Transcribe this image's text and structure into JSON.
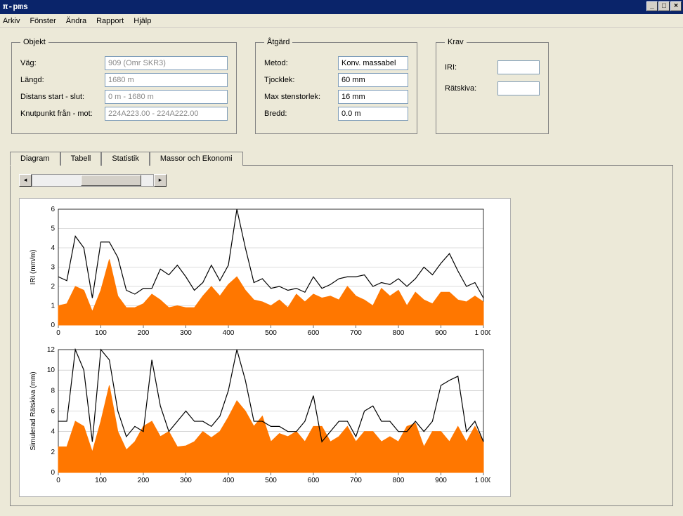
{
  "title": "π-pms",
  "menu": [
    "Arkiv",
    "Fönster",
    "Ändra",
    "Rapport",
    "Hjälp"
  ],
  "objekt": {
    "legend": "Objekt",
    "vag_label": "Väg:",
    "vag_value": "909 (Omr SKR3)",
    "langd_label": "Längd:",
    "langd_value": "1680 m",
    "dist_label": "Distans start - slut:",
    "dist_value": "0 m - 1680 m",
    "knut_label": "Knutpunkt från - mot:",
    "knut_value": "224A223.00 - 224A222.00"
  },
  "atgard": {
    "legend": "Åtgärd",
    "metod_label": "Metod:",
    "metod_value": "Konv. massabel",
    "tjocklek_label": "Tjocklek:",
    "tjocklek_value": "60 mm",
    "maxsten_label": "Max stenstorlek:",
    "maxsten_value": "16 mm",
    "bredd_label": "Bredd:",
    "bredd_value": "0.0 m"
  },
  "krav": {
    "legend": "Krav",
    "iri_label": "IRI:",
    "iri_value": "",
    "rat_label": "Rätskiva:",
    "rat_value": ""
  },
  "tabs": {
    "diagram": "Diagram",
    "tabell": "Tabell",
    "statistik": "Statistik",
    "massor": "Massor och Ekonomi"
  },
  "chart_data": [
    {
      "type": "line",
      "title": "",
      "ylabel": "IRI (mm/m)",
      "xlabel": "",
      "ylim": [
        0,
        6
      ],
      "xlim": [
        0,
        1000
      ],
      "x_step": 100,
      "y_step": 1,
      "x": [
        0,
        20,
        40,
        60,
        80,
        100,
        120,
        140,
        160,
        180,
        200,
        220,
        240,
        260,
        280,
        300,
        320,
        340,
        360,
        380,
        400,
        420,
        440,
        460,
        480,
        500,
        520,
        540,
        560,
        580,
        600,
        620,
        640,
        660,
        680,
        700,
        720,
        740,
        760,
        780,
        800,
        820,
        840,
        860,
        880,
        900,
        920,
        940,
        960,
        980,
        1000
      ],
      "series": [
        {
          "name": "black",
          "color": "#000",
          "values": [
            2.5,
            2.3,
            4.6,
            4.0,
            1.4,
            4.3,
            4.3,
            3.5,
            1.8,
            1.6,
            1.9,
            1.9,
            2.9,
            2.6,
            3.1,
            2.5,
            1.8,
            2.2,
            3.1,
            2.3,
            3.1,
            6.0,
            4.0,
            2.2,
            2.4,
            1.9,
            2.0,
            1.8,
            1.9,
            1.7,
            2.5,
            1.9,
            2.1,
            2.4,
            2.5,
            2.5,
            2.6,
            2.0,
            2.2,
            2.1,
            2.4,
            2.0,
            2.4,
            3.0,
            2.6,
            3.2,
            3.7,
            2.8,
            2.0,
            2.2,
            1.4
          ]
        },
        {
          "name": "orange",
          "color": "#ff7700",
          "type": "area",
          "values": [
            1.0,
            1.1,
            2.0,
            1.8,
            0.7,
            1.8,
            3.4,
            1.5,
            0.9,
            0.9,
            1.1,
            1.6,
            1.3,
            0.9,
            1.0,
            0.9,
            0.9,
            1.5,
            2.0,
            1.5,
            2.1,
            2.5,
            1.8,
            1.3,
            1.2,
            1.0,
            1.3,
            0.9,
            1.6,
            1.2,
            1.6,
            1.4,
            1.5,
            1.3,
            2.0,
            1.5,
            1.3,
            1.0,
            1.9,
            1.5,
            1.8,
            1.0,
            1.7,
            1.3,
            1.1,
            1.7,
            1.7,
            1.3,
            1.2,
            1.5,
            1.2
          ]
        }
      ]
    },
    {
      "type": "line",
      "title": "",
      "ylabel": "Simulerad Rätskiva (mm)",
      "xlabel": "",
      "ylim": [
        0,
        12
      ],
      "xlim": [
        0,
        1000
      ],
      "x_step": 100,
      "y_step": 2,
      "x": [
        0,
        20,
        40,
        60,
        80,
        100,
        120,
        140,
        160,
        180,
        200,
        220,
        240,
        260,
        280,
        300,
        320,
        340,
        360,
        380,
        400,
        420,
        440,
        460,
        480,
        500,
        520,
        540,
        560,
        580,
        600,
        620,
        640,
        660,
        680,
        700,
        720,
        740,
        760,
        780,
        800,
        820,
        840,
        860,
        880,
        900,
        920,
        940,
        960,
        980,
        1000
      ],
      "series": [
        {
          "name": "black",
          "color": "#000",
          "values": [
            5.0,
            5.0,
            12.0,
            10.0,
            3.0,
            12.0,
            11.0,
            6.0,
            3.5,
            4.5,
            4.0,
            11.0,
            6.5,
            4.0,
            5.0,
            6.0,
            5.0,
            5.0,
            4.5,
            5.5,
            8.0,
            12.0,
            9.0,
            5.0,
            5.0,
            4.5,
            4.5,
            4.0,
            4.0,
            5.0,
            7.5,
            3.0,
            4.0,
            5.0,
            5.0,
            3.5,
            6.0,
            6.5,
            5.0,
            5.0,
            4.0,
            4.0,
            5.0,
            4.0,
            5.0,
            8.5,
            9.0,
            9.4,
            4.0,
            5.0,
            3.0
          ]
        },
        {
          "name": "orange",
          "color": "#ff7700",
          "type": "area",
          "values": [
            2.5,
            2.5,
            5.0,
            4.5,
            2.0,
            5.0,
            8.5,
            4.0,
            2.2,
            3.0,
            4.5,
            5.0,
            3.5,
            4.0,
            2.5,
            2.6,
            3.0,
            4.0,
            3.4,
            4.0,
            5.4,
            7.0,
            6.0,
            4.5,
            5.5,
            3.0,
            3.8,
            3.5,
            4.0,
            3.0,
            4.5,
            4.5,
            3.0,
            3.5,
            4.5,
            3.0,
            4.0,
            4.0,
            3.0,
            3.5,
            3.0,
            4.5,
            4.8,
            2.5,
            4.0,
            4.0,
            3.0,
            4.5,
            3.0,
            4.5,
            3.0
          ]
        }
      ]
    }
  ]
}
